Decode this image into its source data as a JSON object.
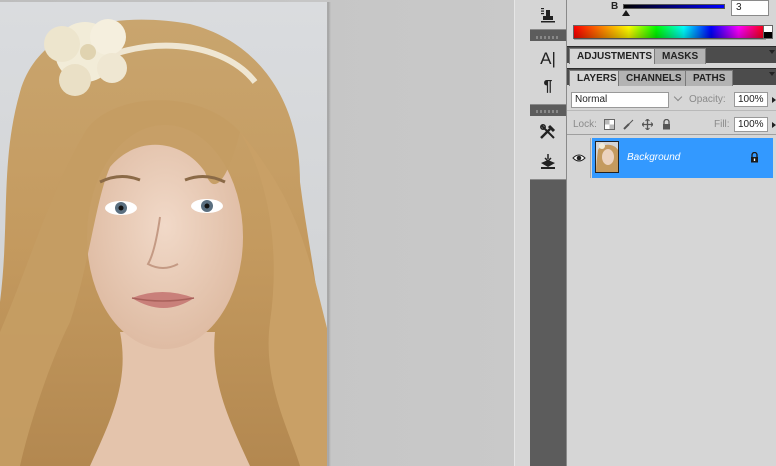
{
  "color_panel": {
    "channel_label": "B",
    "channel_value": "3"
  },
  "adjustments_tabs": [
    {
      "label": "ADJUSTMENTS",
      "active": true
    },
    {
      "label": "MASKS",
      "active": false
    }
  ],
  "layers_tabs": [
    {
      "label": "LAYERS",
      "active": true
    },
    {
      "label": "CHANNELS",
      "active": false
    },
    {
      "label": "PATHS",
      "active": false
    }
  ],
  "layers_options": {
    "blend_mode": "Normal",
    "opacity_label": "Opacity:",
    "opacity_value": "100%",
    "lock_label": "Lock:",
    "fill_label": "Fill:",
    "fill_value": "100%"
  },
  "layers": [
    {
      "name": "Background",
      "visible": true,
      "locked": true,
      "selected": true
    }
  ],
  "colors": {
    "selected_layer": "#3399ff",
    "panel_bg": "#d6d6d6",
    "tab_strip": "#4c4c4c"
  },
  "icons": {
    "tool_column": [
      "clone-source-icon",
      "character-icon",
      "paragraph-icon",
      "tool-presets-icon",
      "stamp-icon"
    ],
    "lock_options": [
      "lock-transparent-icon",
      "lock-image-icon",
      "lock-position-icon",
      "lock-all-icon"
    ]
  }
}
